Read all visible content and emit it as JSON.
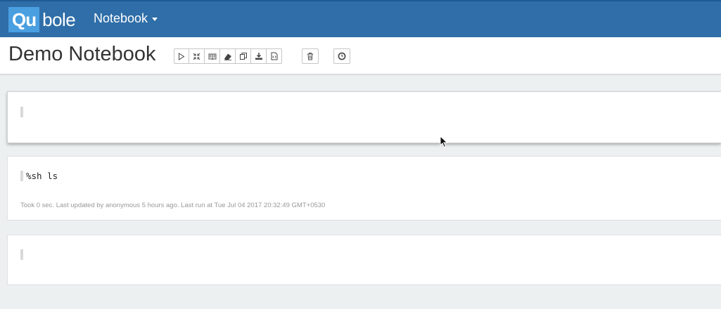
{
  "app": {
    "logo_qu": "Qu",
    "logo_bole": "bole",
    "nav_menu_label": "Notebook"
  },
  "notebook": {
    "title": "Demo Notebook",
    "toolbar": [
      {
        "name": "run-all-button",
        "icon": "play-icon"
      },
      {
        "name": "toggle-code-button",
        "icon": "collapse-icon"
      },
      {
        "name": "toggle-output-button",
        "icon": "book-icon"
      },
      {
        "name": "clear-output-button",
        "icon": "eraser-icon"
      },
      {
        "name": "clone-button",
        "icon": "copy-icon"
      },
      {
        "name": "export-button",
        "icon": "download-icon"
      },
      {
        "name": "version-button",
        "icon": "file-code-icon"
      }
    ],
    "delete_icon": "trash-icon",
    "scheduler_icon": "clock-icon"
  },
  "paragraphs": [
    {
      "code": "",
      "meta": ""
    },
    {
      "code": "%sh ls",
      "meta": "Took 0 sec. Last updated by anonymous 5 hours ago. Last run at Tue Jul 04 2017 20:32:49 GMT+0530"
    },
    {
      "code": "",
      "meta": ""
    }
  ]
}
